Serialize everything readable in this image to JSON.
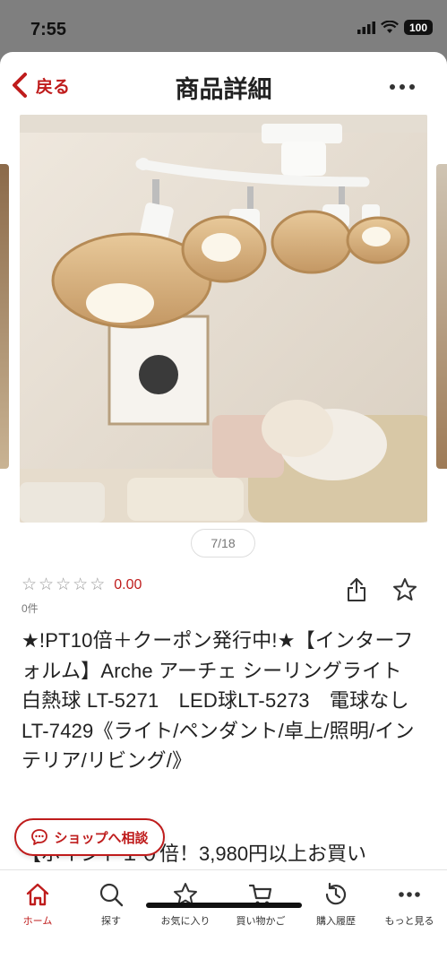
{
  "status": {
    "time": "7:55",
    "battery": "100"
  },
  "nav": {
    "back_label": "戻る",
    "title": "商品詳細"
  },
  "gallery": {
    "counter": "7/18"
  },
  "rating": {
    "value": "0.00",
    "review_count": "0件"
  },
  "product": {
    "title": "★!PT10倍＋クーポン発行中!★【インターフォルム】Arche アーチェ シーリングライト　白熱球 LT-5271　LED球LT-5273　電球なしLT-7429《ライト/ペンダント/卓上/照明/インテリア/リビング/》",
    "promo": "【ポイント１０倍！3,980円以上お買い"
  },
  "shop_consult_label": "ショップへ相談",
  "tabs": [
    {
      "label": "ホーム",
      "icon": "home-icon",
      "active": true
    },
    {
      "label": "探す",
      "icon": "search-icon",
      "active": false
    },
    {
      "label": "お気に入り",
      "icon": "star-icon",
      "active": false
    },
    {
      "label": "買い物かご",
      "icon": "cart-icon",
      "active": false
    },
    {
      "label": "購入履歴",
      "icon": "history-icon",
      "active": false
    },
    {
      "label": "もっと見る",
      "icon": "more-icon",
      "active": false
    }
  ],
  "colors": {
    "accent": "#bf1c1c",
    "status_bar": "#7f7f7f"
  }
}
